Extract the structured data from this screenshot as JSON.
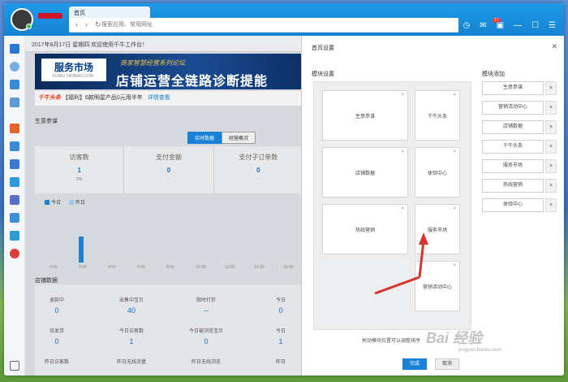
{
  "browser": {
    "tab_title": "首页",
    "search_placeholder": "搜索应用、常用网址",
    "back_icon": "‹",
    "forward_icon": "›",
    "refresh_icon": "↻",
    "notify_badge": "17"
  },
  "header": {
    "date_greeting": "2017年8月17日 星期四  欢迎使用千牛工作台！"
  },
  "banner": {
    "logo_main": "服务市场",
    "logo_sub": "FUWU.TAOBAO.COM",
    "tagline": "商家智慧经营系列论坛",
    "headline": "店铺运营全链路诊断提能"
  },
  "notice": {
    "brand": "千牛头条",
    "text": "【福利】6款明星产品0元用半年",
    "link": "详情查看"
  },
  "business": {
    "section_title": "生意参谋",
    "tabs": [
      "实时数据",
      "经营概况"
    ],
    "metrics": [
      {
        "label": "访客数",
        "value": "1",
        "sub": "0%"
      },
      {
        "label": "支付金额",
        "value": "0",
        "sub": "-"
      },
      {
        "label": "支付子订单数",
        "value": "0",
        "sub": "-"
      }
    ],
    "legend": [
      "今日",
      "昨日"
    ],
    "x_ticks": [
      "0:00",
      "2:00",
      "4:00",
      "6:00",
      "8:00",
      "10:00",
      "12:00",
      "14:00",
      "16:00"
    ]
  },
  "shop": {
    "section_title": "店铺数据",
    "row1": [
      {
        "label": "退款中",
        "value": "0"
      },
      {
        "label": "出售中宝贝",
        "value": "40"
      },
      {
        "label": "限时打折",
        "value": "--"
      },
      {
        "label": "今日",
        "value": "0"
      }
    ],
    "row2": [
      {
        "label": "待发货",
        "value": "0"
      },
      {
        "label": "今日访客数",
        "value": "1"
      },
      {
        "label": "今日被浏览宝贝",
        "value": "0"
      },
      {
        "label": "今日",
        "value": "1"
      }
    ],
    "row3": [
      {
        "label": "昨日访客数"
      },
      {
        "label": "昨日无线流量"
      },
      {
        "label": "昨日无线浏览"
      },
      {
        "label": "昨日"
      }
    ]
  },
  "dialog": {
    "title": "首页设置",
    "left_label": "模块设置",
    "right_label": "模块添加",
    "close_icon": "✕",
    "modules": [
      "生意参谋",
      "千牛头条",
      "店铺数据",
      "体验中心",
      "热线营销",
      "服务市场",
      "营销活动中心"
    ],
    "available": [
      "生意参谋",
      "营销活动中心",
      "店铺数据",
      "千牛头条",
      "服务市场",
      "热线营销",
      "体验中心"
    ],
    "remove_symbol": "×",
    "hint": "拖动模块位置可以调整排序",
    "ok_label": "完成",
    "cancel_label": "取消"
  },
  "watermark": {
    "text": "Bai 经验",
    "sub": "jingyan.baidu.com"
  }
}
